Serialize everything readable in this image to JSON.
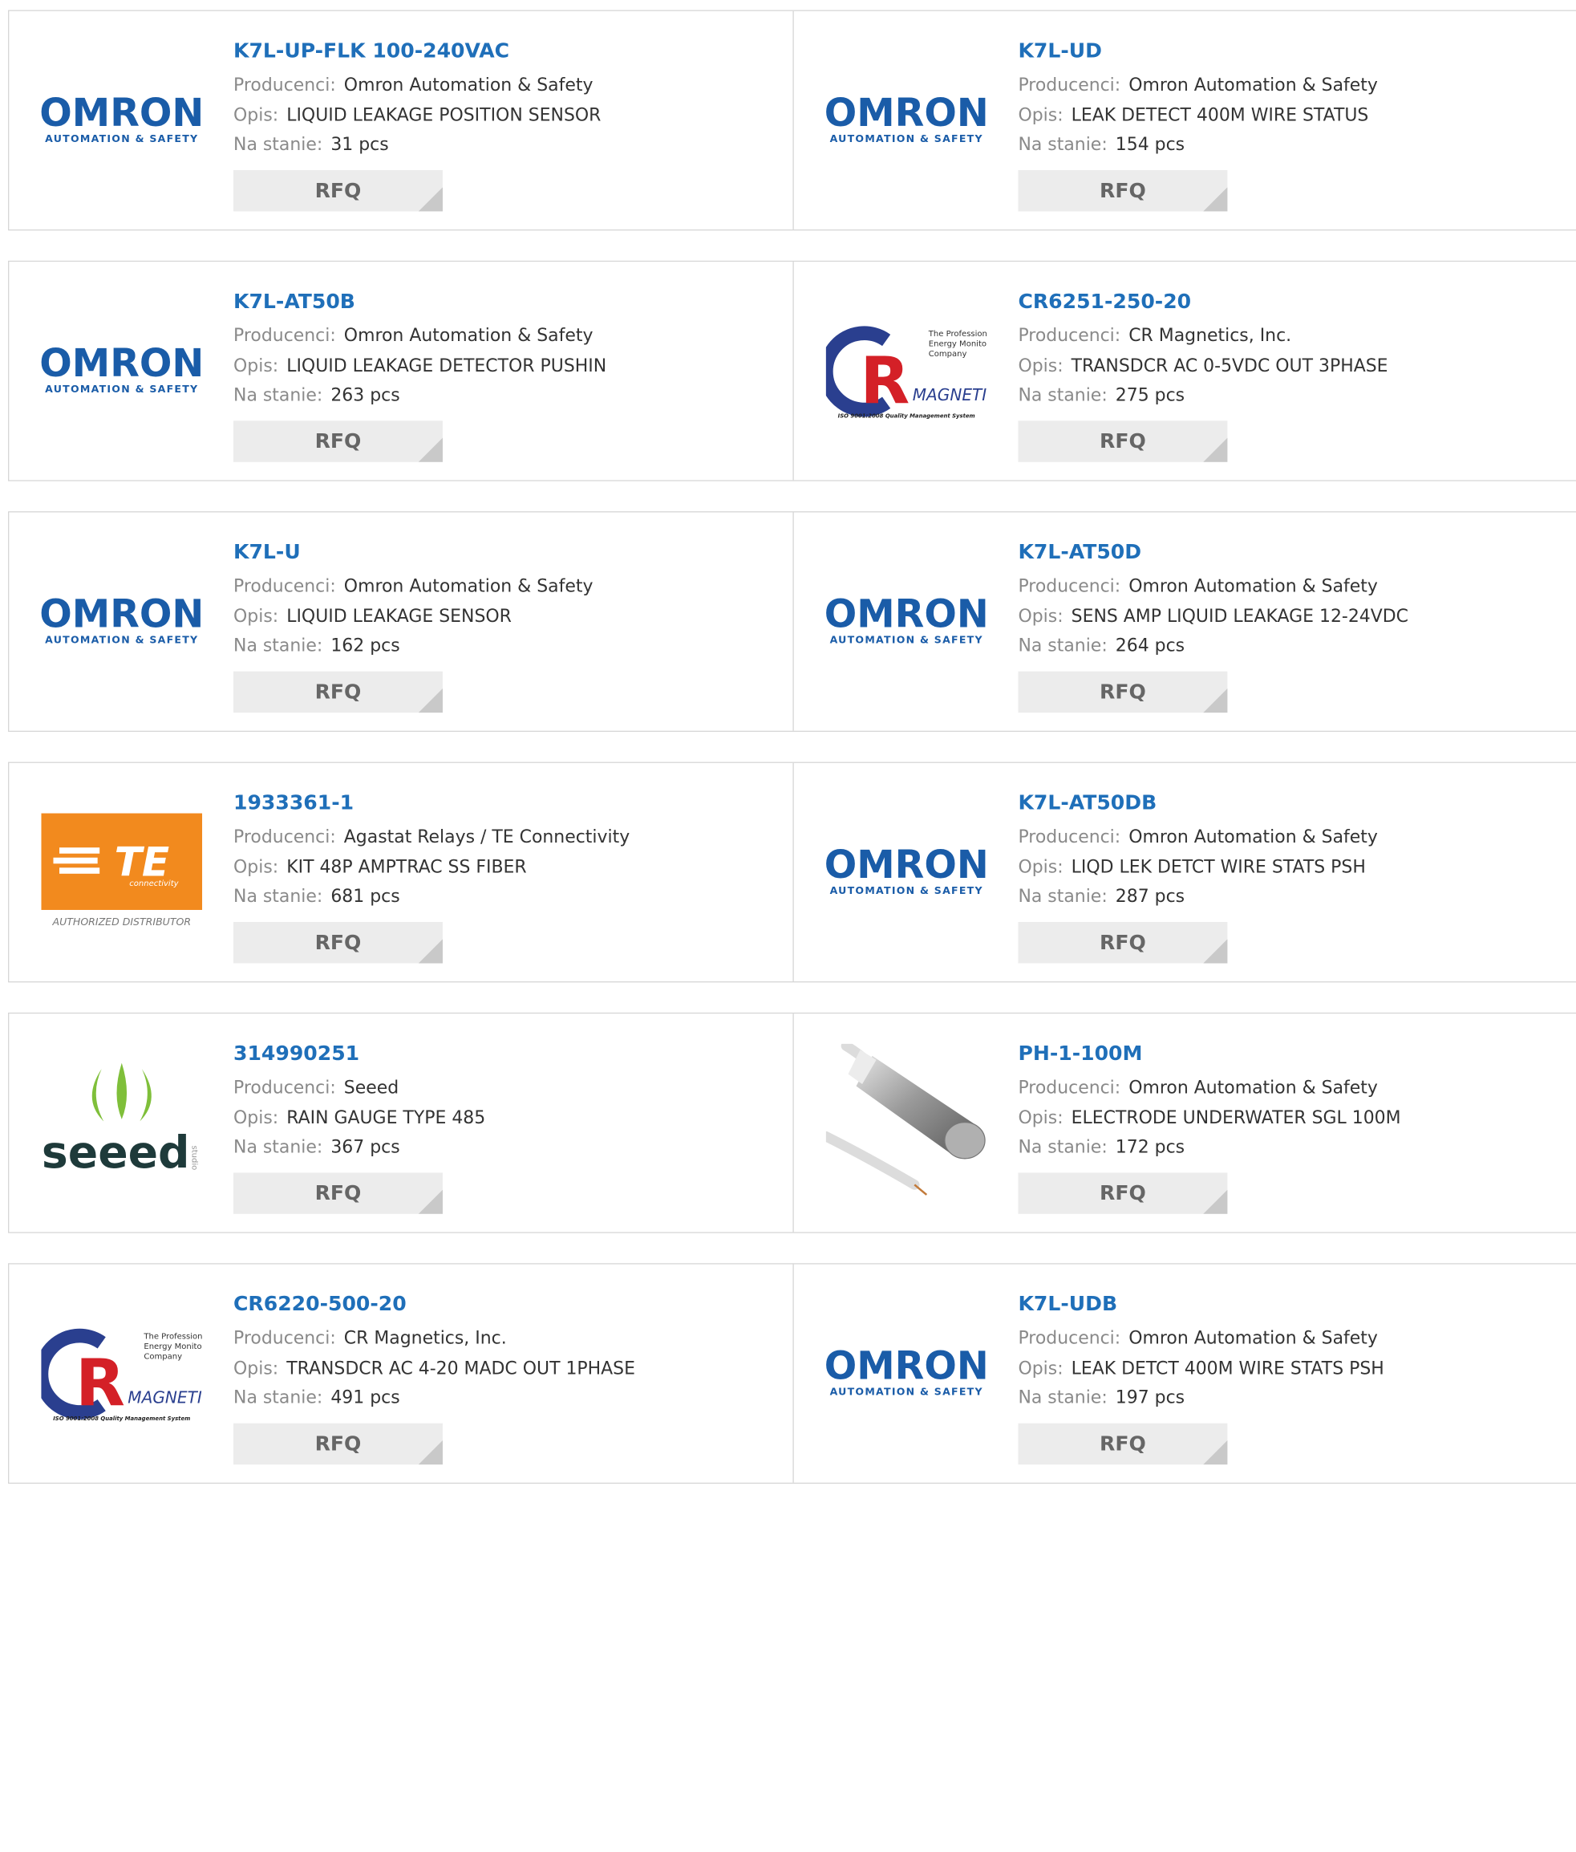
{
  "labels": {
    "manufacturer": "Producenci:",
    "description": "Opis:",
    "stock": "Na stanie:",
    "rfq": "RFQ"
  },
  "logo_text": {
    "omron_title": "OMRON",
    "omron_sub": "AUTOMATION & SAFETY",
    "cr_line1": "The Professional",
    "cr_line2": "Energy Monitoring",
    "cr_line3": "Company",
    "cr_magnetics": "MAGNETICS",
    "cr_iso": "ISO 9001:2008 Quality Management System",
    "te_title": "TE",
    "te_sub": "connectivity",
    "te_authorized": "AUTHORIZED DISTRIBUTOR",
    "seeed_title": "seeed",
    "seeed_side": "studio"
  },
  "colors": {
    "link": "#1f6fb9",
    "omron": "#1a5ca8",
    "te_orange": "#f28a1e",
    "seeed_green": "#7fbf3a",
    "cr_red": "#d42027",
    "cr_blue": "#2a3f8f"
  },
  "products": [
    {
      "part": "K7L-UP-FLK 100-240VAC",
      "manufacturer": "Omron Automation & Safety",
      "description": "LIQUID LEAKAGE POSITION SENSOR",
      "stock": "31 pcs",
      "logo": "omron-logo"
    },
    {
      "part": "K7L-UD",
      "manufacturer": "Omron Automation & Safety",
      "description": "LEAK DETECT 400M WIRE STATUS",
      "stock": "154 pcs",
      "logo": "omron-logo"
    },
    {
      "part": "K7L-AT50B",
      "manufacturer": "Omron Automation & Safety",
      "description": "LIQUID LEAKAGE DETECTOR PUSHIN",
      "stock": "263 pcs",
      "logo": "omron-logo"
    },
    {
      "part": "CR6251-250-20",
      "manufacturer": "CR Magnetics, Inc.",
      "description": "TRANSDCR AC 0-5VDC OUT 3PHASE",
      "stock": "275 pcs",
      "logo": "cr-magnetics-logo"
    },
    {
      "part": "K7L-U",
      "manufacturer": "Omron Automation & Safety",
      "description": "LIQUID LEAKAGE SENSOR",
      "stock": "162 pcs",
      "logo": "omron-logo"
    },
    {
      "part": "K7L-AT50D",
      "manufacturer": "Omron Automation & Safety",
      "description": "SENS AMP LIQUID LEAKAGE 12-24VDC",
      "stock": "264 pcs",
      "logo": "omron-logo"
    },
    {
      "part": "1933361-1",
      "manufacturer": "Agastat Relays / TE Connectivity",
      "description": "KIT 48P AMPTRAC SS FIBER",
      "stock": "681 pcs",
      "logo": "te-connectivity-logo"
    },
    {
      "part": "K7L-AT50DB",
      "manufacturer": "Omron Automation & Safety",
      "description": "LIQD LEK DETCT WIRE STATS PSH",
      "stock": "287 pcs",
      "logo": "omron-logo"
    },
    {
      "part": "314990251",
      "manufacturer": "Seeed",
      "description": "RAIN GAUGE TYPE 485",
      "stock": "367 pcs",
      "logo": "seeed-logo"
    },
    {
      "part": "PH-1-100M",
      "manufacturer": "Omron Automation & Safety",
      "description": "ELECTRODE UNDERWATER SGL 100M",
      "stock": "172 pcs",
      "logo": "electrode-product-image"
    },
    {
      "part": "CR6220-500-20",
      "manufacturer": "CR Magnetics, Inc.",
      "description": "TRANSDCR AC 4-20 MADC OUT 1PHASE",
      "stock": "491 pcs",
      "logo": "cr-magnetics-logo"
    },
    {
      "part": "K7L-UDB",
      "manufacturer": "Omron Automation & Safety",
      "description": "LEAK DETCT 400M WIRE STATS PSH",
      "stock": "197 pcs",
      "logo": "omron-logo"
    }
  ]
}
